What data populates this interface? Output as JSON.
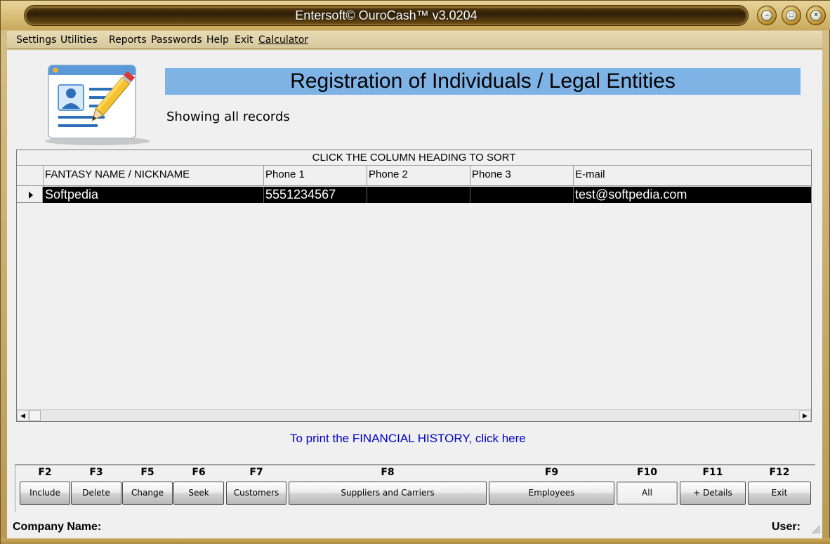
{
  "window": {
    "title": "Entersoft© OuroCash™ v3.0204"
  },
  "menu": {
    "items": [
      "Settings",
      "Utilities",
      "Reports",
      "Passwords",
      "Help",
      "Exit",
      "Calculator"
    ]
  },
  "header": {
    "title": "Registration of Individuals / Legal Entities",
    "subtitle": "Showing all records"
  },
  "grid": {
    "caption": "CLICK THE COLUMN HEADING TO SORT",
    "columns": [
      "FANTASY NAME / NICKNAME",
      "Phone 1",
      "Phone 2",
      "Phone 3",
      "E-mail"
    ],
    "rows": [
      [
        "Softpedia",
        "5551234567",
        "",
        "",
        "test@softpedia.com"
      ]
    ]
  },
  "print_link": "To print the FINANCIAL HISTORY, click here",
  "function_keys": [
    {
      "key": "F2",
      "label": "Include"
    },
    {
      "key": "F3",
      "label": "Delete"
    },
    {
      "key": "F5",
      "label": "Change"
    },
    {
      "key": "F6",
      "label": "Seek"
    },
    {
      "key": "F7",
      "label": "Customers"
    },
    {
      "key": "F8",
      "label": "Suppliers and Carriers"
    },
    {
      "key": "F9",
      "label": "Employees"
    },
    {
      "key": "F10",
      "label": "All"
    },
    {
      "key": "F11",
      "label": "+ Details"
    },
    {
      "key": "F12",
      "label": "Exit"
    }
  ],
  "status": {
    "company_label": "Company Name:",
    "user_label": "User:"
  },
  "icons": [
    "contact-card-icon",
    "pencil-icon",
    "minimize-icon",
    "maximize-icon",
    "close-icon",
    "resize-grip-icon"
  ],
  "colors": {
    "heading_bar": "#7fb3e6",
    "selected_row": "#000000",
    "link": "#0000cc"
  }
}
